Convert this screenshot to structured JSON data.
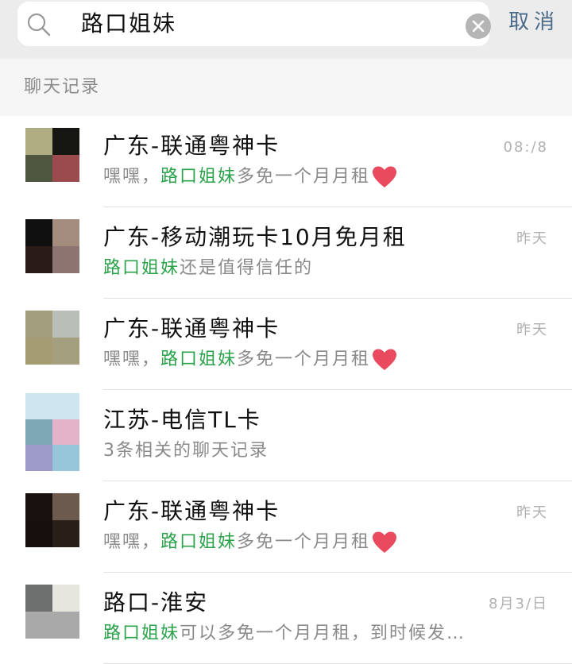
{
  "search": {
    "query": "路口姐妹",
    "cancel_label": "取消"
  },
  "section": {
    "title": "聊天记录"
  },
  "colors": {
    "highlight": "#2aa24a",
    "cancel": "#4a6a8a",
    "heart": "#ea4a5e"
  },
  "results": [
    {
      "title": "广东-联通粤神卡",
      "time": "08:/8",
      "pre": "嘿嘿，",
      "match": "路口姐妹",
      "post": "多免一个月月租",
      "heart": true,
      "avatar": [
        "#b0ad82",
        "#161613",
        "#4f5741",
        "#9b4a4e"
      ]
    },
    {
      "title": "广东-移动潮玩卡10月免月租",
      "time": "昨天",
      "pre": "",
      "match": "路口姐妹",
      "post": "还是值得信任的",
      "heart": false,
      "avatar": [
        "#0f0f10",
        "#a38b7e",
        "#2a1b18",
        "#8d7470"
      ]
    },
    {
      "title": "广东-联通粤神卡",
      "time": "昨天",
      "pre": "嘿嘿，",
      "match": "路口姐妹",
      "post": "多免一个月月租",
      "heart": true,
      "avatar": [
        "#a39f7d",
        "#b9bfb7",
        "#a59c74",
        "#a49f7f"
      ]
    },
    {
      "title": "江苏-电信TL卡",
      "time": "",
      "pre": "3条相关的聊天记录",
      "match": "",
      "post": "",
      "heart": false,
      "avatar": [
        "#cfe6f1",
        "#cfe6f1",
        "#7fa8b7",
        "#e2b3c9",
        "#9c9ac7",
        "#96c6d8"
      ]
    },
    {
      "title": "广东-联通粤神卡",
      "time": "昨天",
      "pre": "嘿嘿，",
      "match": "路口姐妹",
      "post": "多免一个月月租",
      "heart": true,
      "avatar": [
        "#19110e",
        "#6b5a4d",
        "#170f0d",
        "#2a1e18"
      ]
    },
    {
      "title": "路口-淮安",
      "time": "8月3/日",
      "pre": "",
      "match": "路口姐妹",
      "post": "可以多免一个月月租，到时候发…",
      "heart": false,
      "avatar": [
        "#6d6e6e",
        "#e6e6df",
        "#a9a9a9",
        "#a9a9a9"
      ]
    }
  ]
}
